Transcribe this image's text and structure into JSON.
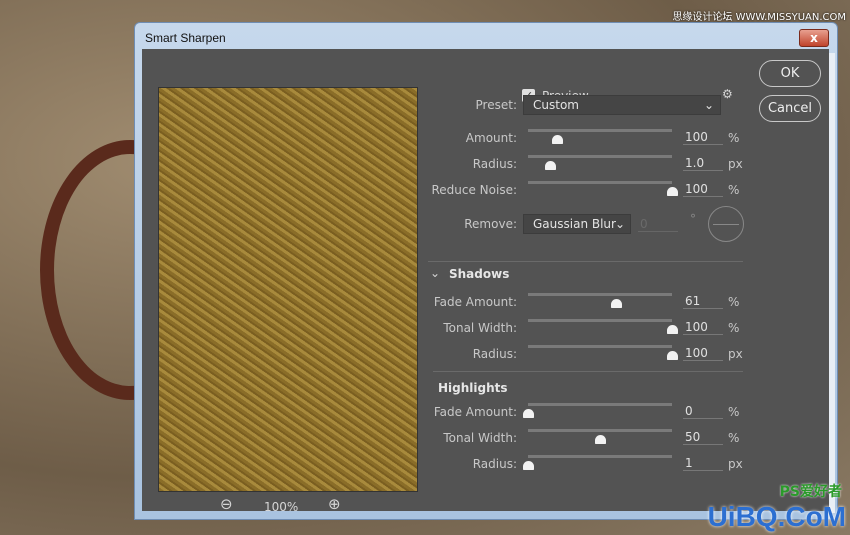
{
  "window": {
    "title": "Smart Sharpen",
    "close_label": "x"
  },
  "watermarks": {
    "top": "思缘设计论坛 WWW.MISSYUAN.COM",
    "bottom": "UiBQ.CoM",
    "bottom_small": "PS爱好者"
  },
  "preview": {
    "checkbox_label": "Preview",
    "checked": true,
    "zoom_level": "100%"
  },
  "buttons": {
    "ok": "OK",
    "cancel": "Cancel"
  },
  "preset": {
    "label": "Preset:",
    "value": "Custom"
  },
  "main_controls": [
    {
      "label": "Amount:",
      "value": "100",
      "unit": "%",
      "slider": 0.2
    },
    {
      "label": "Radius:",
      "value": "1.0",
      "unit": "px",
      "slider": 0.15
    },
    {
      "label": "Reduce Noise:",
      "value": "100",
      "unit": "%",
      "slider": 1.0
    }
  ],
  "remove": {
    "label": "Remove:",
    "value": "Gaussian Blur",
    "angle": "0",
    "angle_unit": "°"
  },
  "shadows": {
    "title": "Shadows",
    "controls": [
      {
        "label": "Fade Amount:",
        "value": "61",
        "unit": "%",
        "slider": 0.61
      },
      {
        "label": "Tonal Width:",
        "value": "100",
        "unit": "%",
        "slider": 1.0
      },
      {
        "label": "Radius:",
        "value": "100",
        "unit": "px",
        "slider": 1.0
      }
    ]
  },
  "highlights": {
    "title": "Highlights",
    "controls": [
      {
        "label": "Fade Amount:",
        "value": "0",
        "unit": "%",
        "slider": 0
      },
      {
        "label": "Tonal Width:",
        "value": "50",
        "unit": "%",
        "slider": 0.5
      },
      {
        "label": "Radius:",
        "value": "1",
        "unit": "px",
        "slider": 0
      }
    ]
  }
}
